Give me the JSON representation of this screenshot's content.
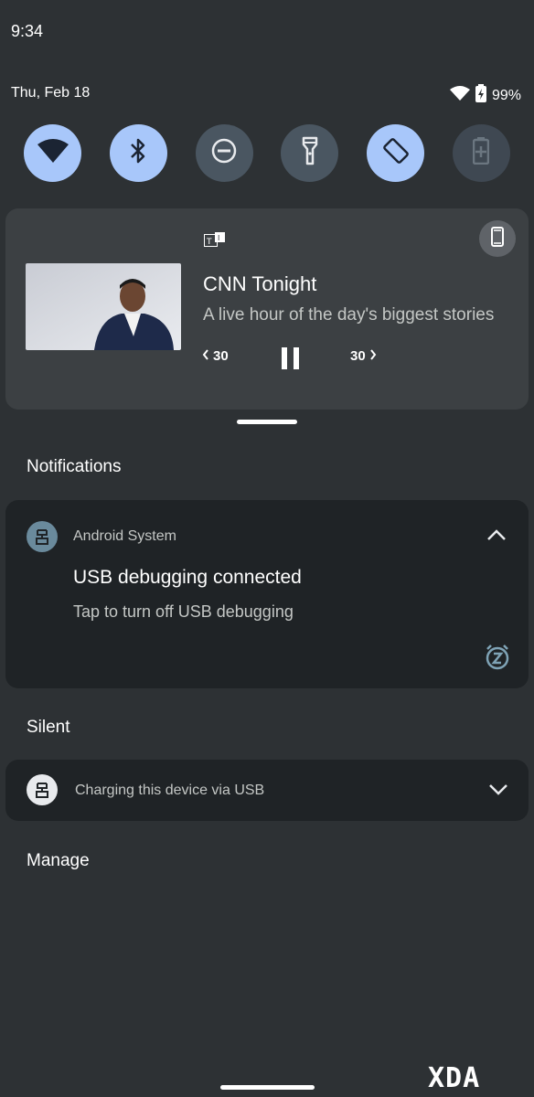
{
  "status_bar": {
    "time": "9:34",
    "date": "Thu, Feb 18",
    "battery": "99%"
  },
  "quick_settings": [
    {
      "name": "wifi-icon",
      "state": "on"
    },
    {
      "name": "bluetooth-icon",
      "state": "on"
    },
    {
      "name": "do-not-disturb-icon",
      "state": "off"
    },
    {
      "name": "flashlight-icon",
      "state": "off"
    },
    {
      "name": "auto-rotate-icon",
      "state": "on"
    },
    {
      "name": "battery-saver-icon",
      "state": "disabled"
    }
  ],
  "media": {
    "title": "CNN Tonight",
    "subtitle": "A live hour of the day's biggest stories",
    "rewind_label": "30",
    "forward_label": "30"
  },
  "sections": {
    "notifications": "Notifications",
    "silent": "Silent",
    "manage": "Manage"
  },
  "notification_android": {
    "app": "Android System",
    "title": "USB debugging connected",
    "body": "Tap to turn off USB debugging"
  },
  "notification_charging": {
    "text": "Charging this device via USB"
  },
  "watermark": "XDA",
  "colors": {
    "accent": "#a8c7fa",
    "panel": "#2d3134",
    "card": "#1f2326",
    "media_card": "#3c4043"
  }
}
